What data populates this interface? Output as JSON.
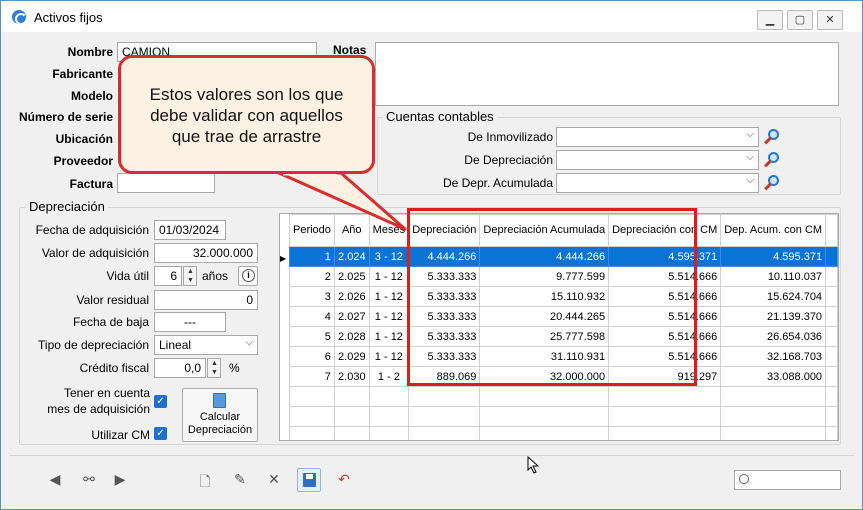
{
  "window": {
    "title": "Activos fijos"
  },
  "form": {
    "nombre_label": "Nombre",
    "nombre_value": "CAMION",
    "fabricante_label": "Fabricante",
    "modelo_label": "Modelo",
    "numero_serie_label": "Número de serie",
    "ubicacion_label": "Ubicación",
    "proveedor_label": "Proveedor",
    "factura_label": "Factura",
    "notas_label": "Notas"
  },
  "cuentas": {
    "title": "Cuentas contables",
    "inmovilizado_label": "De Inmovilizado",
    "depreciacion_label": "De Depreciación",
    "depr_acumulada_label": "De Depr. Acumulada"
  },
  "depreciacion": {
    "title": "Depreciación",
    "fecha_adq_label": "Fecha de adquisición",
    "fecha_adq_value": "01/03/2024",
    "valor_adq_label": "Valor de adquisición",
    "valor_adq_value": "32.000.000",
    "vida_util_label": "Vida útil",
    "vida_util_value": "6",
    "anos_label": "años",
    "valor_residual_label": "Valor residual",
    "valor_residual_value": "0",
    "fecha_baja_label": "Fecha de baja",
    "fecha_baja_value": "---",
    "tipo_label": "Tipo de depreciación",
    "tipo_value": "Lineal",
    "credito_label": "Crédito fiscal",
    "credito_value": "0,0",
    "percent": "%",
    "tener_cuenta_label_1": "Tener en cuenta",
    "tener_cuenta_label_2": "mes de adquisición",
    "utilizar_cm_label": "Utilizar CM",
    "calcular_label_1": "Calcular",
    "calcular_label_2": "Depreciación"
  },
  "grid": {
    "headers": [
      "Periodo",
      "Año",
      "Meses",
      "Depreciación",
      "Depreciación Acumulada",
      "Depreciación con CM",
      "Dep. Acum. con CM"
    ],
    "rows": [
      [
        "1",
        "2.024",
        "3 - 12",
        "4.444.266",
        "4.444.266",
        "4.595.371",
        "4.595.371"
      ],
      [
        "2",
        "2.025",
        "1 - 12",
        "5.333.333",
        "9.777.599",
        "5.514.666",
        "10.110.037"
      ],
      [
        "3",
        "2.026",
        "1 - 12",
        "5.333.333",
        "15.110.932",
        "5.514.666",
        "15.624.704"
      ],
      [
        "4",
        "2.027",
        "1 - 12",
        "5.333.333",
        "20.444.265",
        "5.514.666",
        "21.139.370"
      ],
      [
        "5",
        "2.028",
        "1 - 12",
        "5.333.333",
        "25.777.598",
        "5.514.666",
        "26.654.036"
      ],
      [
        "6",
        "2.029",
        "1 - 12",
        "5.333.333",
        "31.110.931",
        "5.514.666",
        "32.168.703"
      ],
      [
        "7",
        "2.030",
        "1 - 2",
        "889.069",
        "32.000.000",
        "919.297",
        "33.088.000"
      ]
    ]
  },
  "callout": {
    "line1": "Estos valores son los que",
    "line2": "debe validar con aquellos",
    "line3": "que trae de arrastre"
  },
  "colors": {
    "highlight": "#e31b1b",
    "selection": "#0a74d6",
    "callout_bg": "#fdf1e4"
  }
}
